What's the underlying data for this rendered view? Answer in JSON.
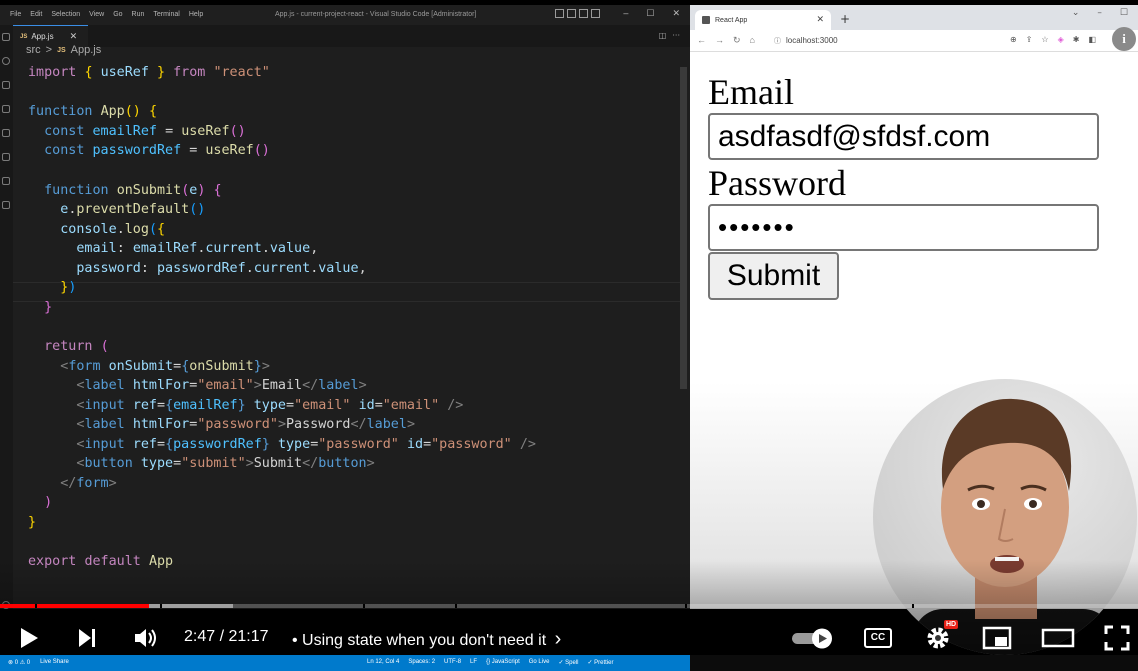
{
  "vscode": {
    "menu": [
      "File",
      "Edit",
      "Selection",
      "View",
      "Go",
      "Run",
      "Terminal",
      "Help"
    ],
    "window_title": "App.js - current-project-react - Visual Studio Code [Administrator]",
    "tab": {
      "badge": "JS",
      "label": "App.js"
    },
    "breadcrumb": {
      "folder": "src",
      "separator": ">",
      "badge": "JS",
      "file": "App.js"
    },
    "status_left": [
      "⊗ 0 ⚠ 0",
      "Live Share"
    ],
    "status_right": [
      "Ln 12, Col 4",
      "Spaces: 2",
      "UTF-8",
      "LF",
      "{} JavaScript",
      "Go Live",
      "✓ Spell",
      "✓ Prettier"
    ]
  },
  "browser": {
    "tab_title": "React App",
    "url": "localhost:3000",
    "profile_initial": "i"
  },
  "page": {
    "email_label": "Email",
    "email_value": "asdfasdf@sfdsf.com",
    "password_label": "Password",
    "password_value": "•••••••",
    "submit_label": "Submit"
  },
  "player": {
    "time": "2:47 / 21:17",
    "chapter": "• Using state when you don't need it",
    "chapter_chevron": "›",
    "hd_badge": "HD",
    "cc_label": "CC",
    "progress_fraction": 0.131,
    "buffer_fraction": 0.205,
    "colors": {
      "played": "#ff0000",
      "accent": "#e62117"
    }
  },
  "colors": {
    "editor_bg": "#1e1e1e",
    "status_bar": "#007acc"
  }
}
